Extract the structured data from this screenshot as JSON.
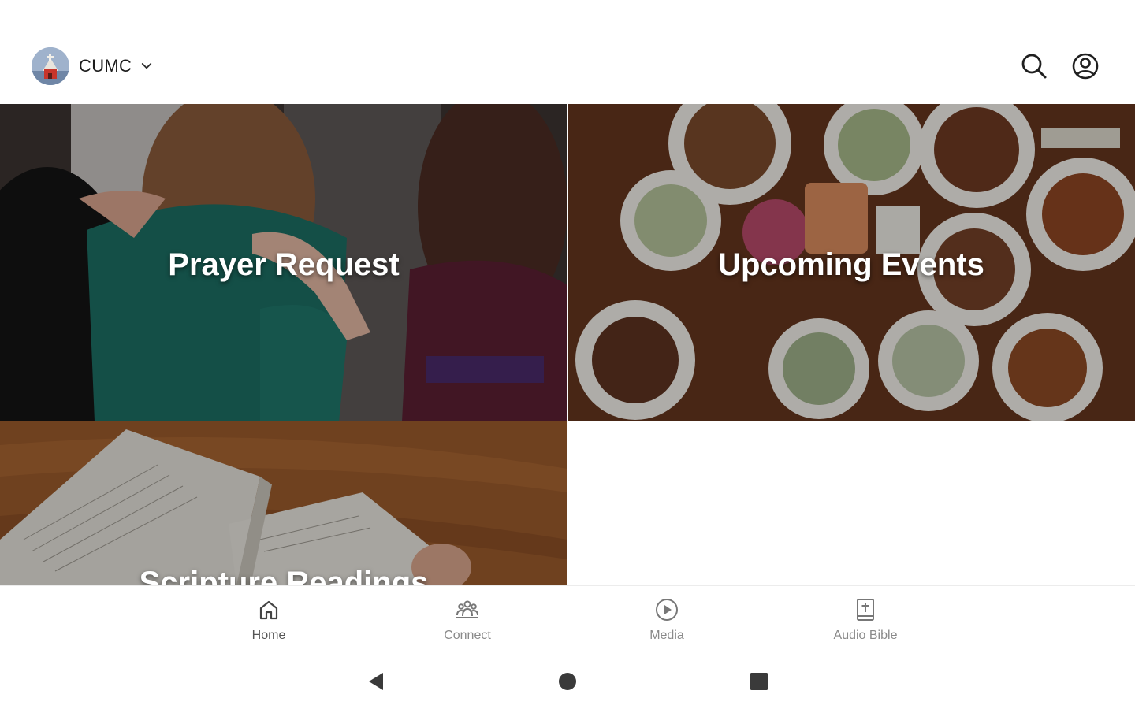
{
  "header": {
    "org_name": "CUMC",
    "avatar_icon": "church-logo-icon",
    "chevron_icon": "chevron-down-icon",
    "search_icon": "search-icon",
    "account_icon": "account-circle-icon"
  },
  "tiles": [
    {
      "title": "Prayer Request",
      "image": "people-praying-photo"
    },
    {
      "title": "Upcoming Events",
      "image": "dinner-table-photo"
    },
    {
      "title": "Scripture Readings",
      "image": "open-bible-photo"
    }
  ],
  "bottom_nav": {
    "items": [
      {
        "label": "Home",
        "icon": "home-icon",
        "active": true
      },
      {
        "label": "Connect",
        "icon": "group-icon",
        "active": false
      },
      {
        "label": "Media",
        "icon": "play-circle-icon",
        "active": false
      },
      {
        "label": "Audio Bible",
        "icon": "bible-icon",
        "active": false
      }
    ]
  },
  "system_nav": {
    "back_icon": "back-triangle-icon",
    "home_icon": "home-circle-icon",
    "recents_icon": "recents-square-icon"
  },
  "colors": {
    "background": "#ffffff",
    "icon": "#2b2b2b",
    "nav_label": "#8a8a8a",
    "tile_text": "#ffffff"
  }
}
